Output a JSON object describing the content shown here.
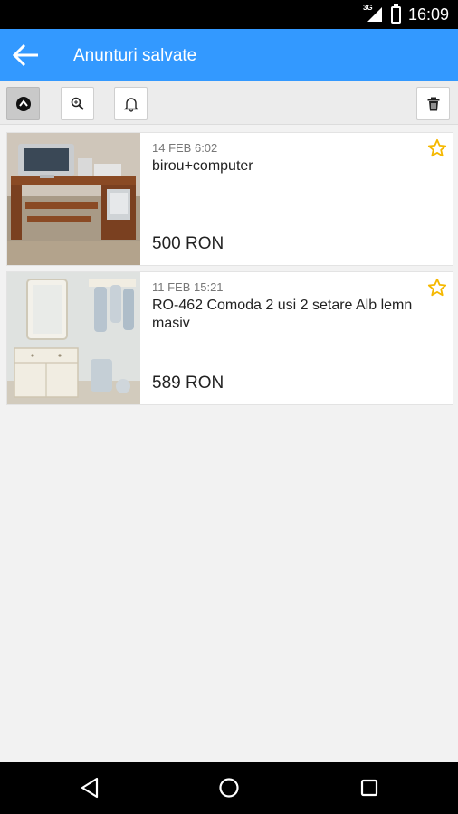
{
  "status_bar": {
    "time": "16:09",
    "network": "3G"
  },
  "app_bar": {
    "title": "Anunturi salvate"
  },
  "toolbar": {
    "buttons": [
      {
        "icon": "sort-up-icon"
      },
      {
        "icon": "search-icon"
      },
      {
        "icon": "bell-icon"
      },
      {
        "icon": "trash-icon"
      }
    ]
  },
  "listings": [
    {
      "date": "14 FEB 6:02",
      "title": "birou+computer",
      "price": "500 RON",
      "favorite": true
    },
    {
      "date": "11 FEB 15:21",
      "title": "RO-462 Comoda 2 usi 2 setare Alb lemn masiv",
      "price": "589 RON",
      "favorite": true
    }
  ],
  "colors": {
    "primary": "#3399ff",
    "star": "#f5b800"
  }
}
